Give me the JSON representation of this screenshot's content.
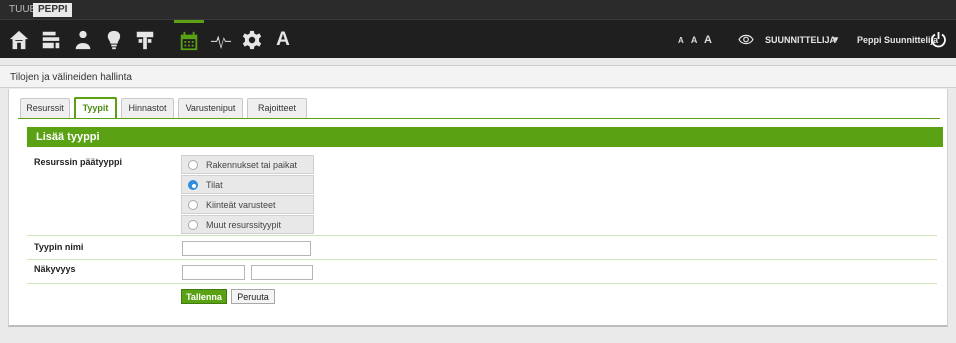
{
  "brandbar": {
    "tuubi": "TUUBI",
    "peppi": "PEPPI"
  },
  "navbar": {
    "icons": [
      "home-icon",
      "layers-icon",
      "person-icon",
      "lightbulb-icon",
      "tools-icon",
      "calendar-icon",
      "activity-icon",
      "gear-icon",
      "font-icon"
    ],
    "font_letter": "A",
    "text_size": [
      "A",
      "A",
      "A"
    ],
    "role": "SUUNNITTELIJA",
    "role_caret": "▼",
    "user": "Peppi Suunnittelija",
    "accent": "#5aa114"
  },
  "breadcrumb": "Tilojen ja välineiden hallinta",
  "tabs": [
    {
      "label": "Resurssit"
    },
    {
      "label": "Tyypit"
    },
    {
      "label": "Hinnastot"
    },
    {
      "label": "Varusteniput"
    },
    {
      "label": "Rajoitteet"
    }
  ],
  "active_tab": "Tyypit",
  "form": {
    "title": "Lisää tyyppi",
    "main_type_label": "Resurssin päätyyppi",
    "options": [
      {
        "label": "Rakennukset tai paikat",
        "checked": false
      },
      {
        "label": "Tilat",
        "checked": true
      },
      {
        "label": "Kiinteät varusteet",
        "checked": false
      },
      {
        "label": "Muut resurssityypit",
        "checked": false
      }
    ],
    "name_label": "Tyypin nimi",
    "name_value": "",
    "visibility_label": "Näkyvyys",
    "visibility_from": "",
    "visibility_to": "",
    "visibility_dash": "-",
    "save_label": "Tallenna",
    "cancel_label": "Peruuta"
  }
}
